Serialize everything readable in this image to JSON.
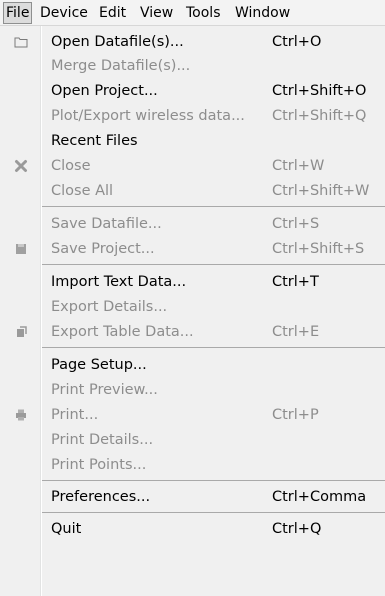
{
  "menubar": {
    "file": "File",
    "device": "Device",
    "edit": "Edit",
    "view": "View",
    "tools": "Tools",
    "window": "Window"
  },
  "file_menu": {
    "open_datafiles": {
      "label": "Open Datafile(s)...",
      "shortcut": "Ctrl+O"
    },
    "merge_datafiles": {
      "label": "Merge Datafile(s)..."
    },
    "open_project": {
      "label": "Open Project...",
      "shortcut": "Ctrl+Shift+O"
    },
    "plot_export_wireless": {
      "label": "Plot/Export wireless data...",
      "shortcut": "Ctrl+Shift+Q"
    },
    "recent_files": {
      "label": "Recent Files"
    },
    "close": {
      "label": "Close",
      "shortcut": "Ctrl+W"
    },
    "close_all": {
      "label": "Close All",
      "shortcut": "Ctrl+Shift+W"
    },
    "save_datafile": {
      "label": "Save Datafile...",
      "shortcut": "Ctrl+S"
    },
    "save_project": {
      "label": "Save Project...",
      "shortcut": "Ctrl+Shift+S"
    },
    "import_text_data": {
      "label": "Import Text Data...",
      "shortcut": "Ctrl+T"
    },
    "export_details": {
      "label": "Export Details..."
    },
    "export_table_data": {
      "label": "Export Table Data...",
      "shortcut": "Ctrl+E"
    },
    "page_setup": {
      "label": "Page Setup..."
    },
    "print_preview": {
      "label": "Print Preview..."
    },
    "print": {
      "label": "Print...",
      "shortcut": "Ctrl+P"
    },
    "print_details": {
      "label": "Print Details..."
    },
    "print_points": {
      "label": "Print Points..."
    },
    "preferences": {
      "label": "Preferences...",
      "shortcut": "Ctrl+Comma"
    },
    "quit": {
      "label": "Quit",
      "shortcut": "Ctrl+Q"
    }
  },
  "colors": {
    "menu_bg": "#f0f0f0",
    "disabled_text": "#8d8d8d",
    "separator": "#a9a9a9"
  }
}
